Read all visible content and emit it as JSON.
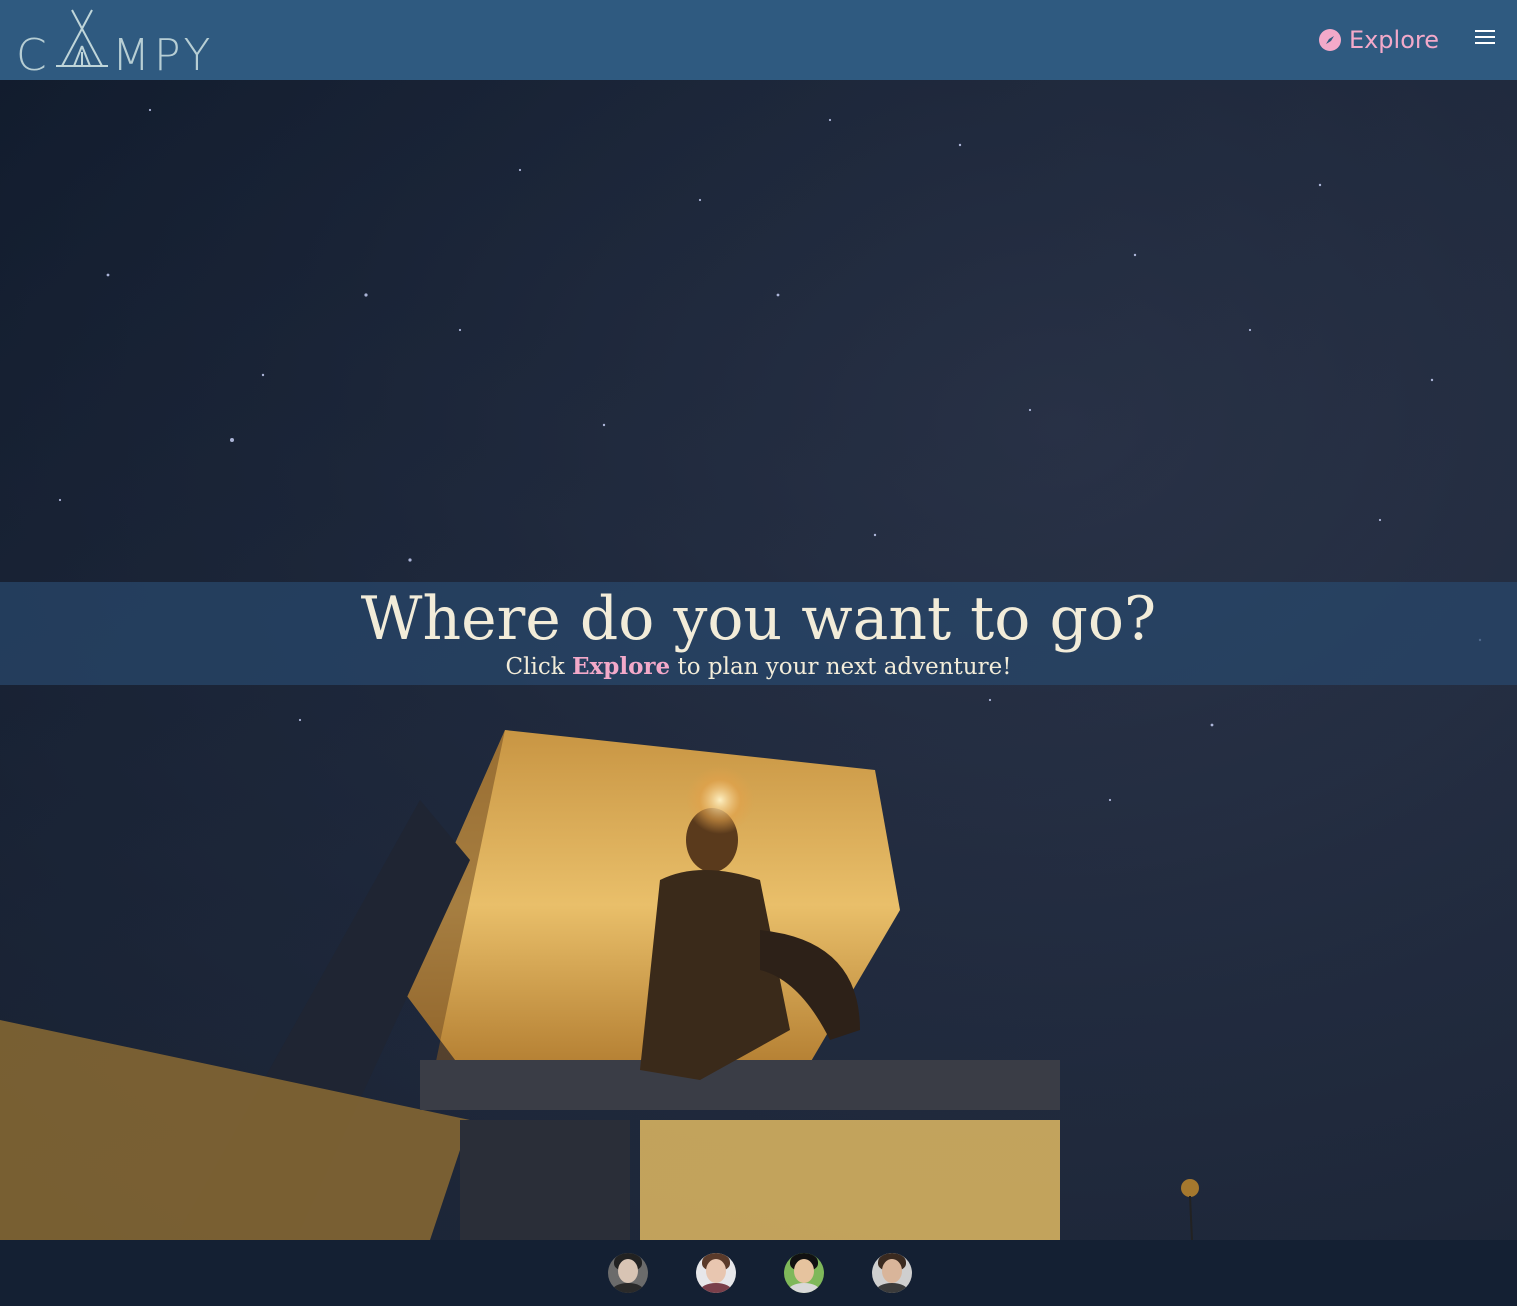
{
  "header": {
    "logo_text": "CAMPY",
    "logo_prefix": "C",
    "logo_suffix": "MPY",
    "explore_label": "Explore",
    "menu_icon": "hamburger-icon",
    "compass_icon": "compass-icon"
  },
  "hero": {
    "heading": "Where do you want to go?",
    "sub_prefix": "Click ",
    "sub_highlight": "Explore",
    "sub_suffix": " to plan your next adventure!"
  },
  "footer": {
    "avatars": [
      {
        "name": "team-avatar-1"
      },
      {
        "name": "team-avatar-2"
      },
      {
        "name": "team-avatar-3"
      },
      {
        "name": "team-avatar-4"
      }
    ]
  },
  "colors": {
    "header_bg": "#2f5a80",
    "accent": "#f3a9c9",
    "banner_text": "#f2ecd9",
    "footer_bg": "#142033"
  }
}
